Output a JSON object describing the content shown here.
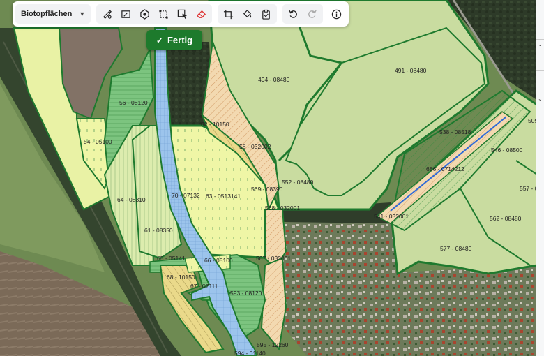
{
  "toolbar": {
    "layer_label": "Biotopflächen",
    "tools": [
      {
        "name": "draw-polygon-icon",
        "title": "draw"
      },
      {
        "name": "edit-shape-icon",
        "title": "edit"
      },
      {
        "name": "target-icon",
        "title": "center"
      },
      {
        "name": "select-rectangle-icon",
        "title": "select"
      },
      {
        "name": "select-cursor-icon",
        "title": "select cursor"
      },
      {
        "name": "eraser-icon",
        "title": "erase"
      },
      {
        "name": "crop-icon",
        "title": "crop"
      },
      {
        "name": "paint-bucket-icon",
        "title": "fill"
      },
      {
        "name": "clipboard-icon",
        "title": "clipboard"
      },
      {
        "name": "undo-icon",
        "title": "undo"
      },
      {
        "name": "redo-icon",
        "title": "redo"
      },
      {
        "name": "info-icon",
        "title": "info"
      }
    ]
  },
  "done_button": {
    "label": "Fertig"
  },
  "map": {
    "labels": [
      "494 - 08480",
      "491 - 08480",
      "56 - 08120",
      "54 - 05100",
      "62 - 10150",
      "58 - 032002",
      "538 - 08518",
      "686 - 0714212",
      "546 - 08500",
      "509",
      "552 - 08480",
      "569 - 08390",
      "70 - 07132",
      "63 - 0513141",
      "64 - 08310",
      "568 - 032001",
      "541 - 032001",
      "562 - 08480",
      "557 - 0",
      "61 - 08350",
      "577 - 08480",
      "65 - 05141",
      "66 - 05100",
      "587 - 032001",
      "68 - 10150",
      "67 - 07111",
      "593 - 08120",
      "595 - 12260",
      "594 - 01140"
    ]
  },
  "colors": {
    "boundary": "#1e7a2e",
    "fertig_bg": "#1d7a2c",
    "meadow": "#c9dca0",
    "pale_yellow": "#eff6a6",
    "water_blue": "#9cc4ec",
    "forest_dark": "#2e3b2a"
  }
}
